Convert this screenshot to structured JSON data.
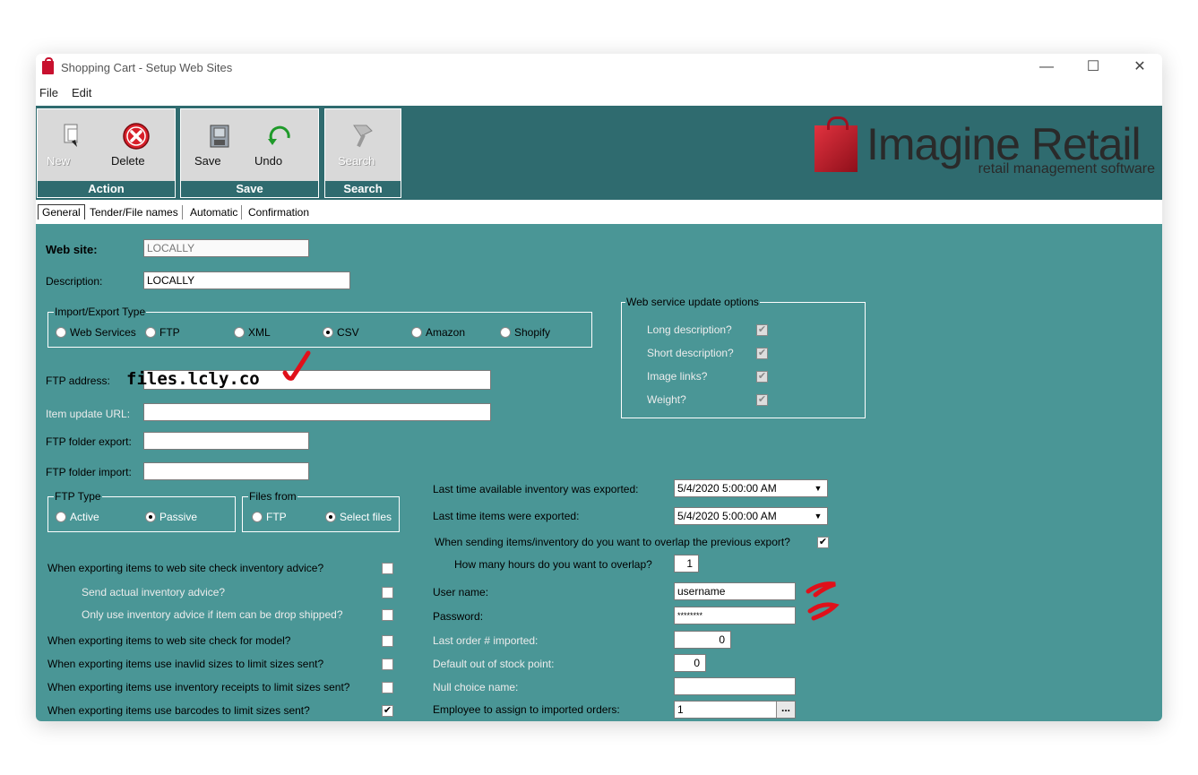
{
  "window": {
    "title": "Shopping Cart - Setup Web Sites",
    "controls": {
      "minimize": "—",
      "maximize": "☐",
      "close": "✕"
    }
  },
  "menu": [
    "File",
    "Edit"
  ],
  "toolbar": {
    "groups": [
      {
        "caption": "Action",
        "buttons": [
          {
            "label": "New",
            "icon": "new-document-icon",
            "enabled": false
          },
          {
            "label": "Delete",
            "icon": "delete-icon",
            "enabled": true
          }
        ]
      },
      {
        "caption": "Save",
        "buttons": [
          {
            "label": "Save",
            "icon": "save-icon",
            "enabled": true
          },
          {
            "label": "Undo",
            "icon": "undo-icon",
            "enabled": true
          }
        ]
      },
      {
        "caption": "Search",
        "buttons": [
          {
            "label": "Search",
            "icon": "search-icon",
            "enabled": false
          }
        ]
      }
    ]
  },
  "logo": {
    "name": "Imagine Retail",
    "tagline": "retail management software"
  },
  "tabs": [
    "General",
    "Tender/File names",
    "Automatic",
    "Confirmation"
  ],
  "form": {
    "web_site": {
      "label": "Web site:",
      "value": "LOCALLY"
    },
    "description": {
      "label": "Description:",
      "value": "LOCALLY"
    },
    "import_export": {
      "title": "Import/Export Type",
      "options": [
        "Web Services",
        "FTP",
        "XML",
        "CSV",
        "Amazon",
        "Shopify"
      ],
      "selected": "CSV"
    },
    "ftp_address": {
      "label": "FTP address:",
      "value": "files.lcly.co"
    },
    "item_update_url": {
      "label": "Item update URL:",
      "value": ""
    },
    "ftp_folder_export": {
      "label": "FTP folder export:",
      "value": ""
    },
    "ftp_folder_import": {
      "label": "FTP folder import:",
      "value": ""
    },
    "ftp_type": {
      "title": "FTP Type",
      "options": [
        "Active",
        "Passive"
      ],
      "selected": "Passive"
    },
    "files_from": {
      "title": "Files from",
      "options": [
        "FTP",
        "Select files"
      ],
      "selected": "Select files"
    },
    "web_service_options": {
      "title": "Web service update options",
      "items": [
        {
          "label": "Long description?",
          "checked": true
        },
        {
          "label": "Short description?",
          "checked": true
        },
        {
          "label": "Image links?",
          "checked": true
        },
        {
          "label": "Weight?",
          "checked": true
        }
      ]
    },
    "left_checks": [
      {
        "label": "When exporting items to web site check inventory advice?",
        "checked": false
      },
      {
        "label": "Send actual inventory advice?",
        "checked": false
      },
      {
        "label": "Only use inventory advice if item can be drop shipped?",
        "checked": false
      },
      {
        "label": "When exporting items to web site check for model?",
        "checked": false
      },
      {
        "label": "When exporting items use inavlid sizes to limit sizes sent?",
        "checked": false
      },
      {
        "label": "When exporting items use inventory receipts to limit sizes sent?",
        "checked": false
      },
      {
        "label": "When exporting items use barcodes to limit sizes sent?",
        "checked": true
      }
    ],
    "last_inventory_export": {
      "label": "Last time available inventory was exported:",
      "value": "5/4/2020 5:00:00 AM"
    },
    "last_items_export": {
      "label": "Last time items were exported:",
      "value": "5/4/2020 5:00:00 AM"
    },
    "overlap_question": {
      "label": "When sending items/inventory do you want to overlap the previous export?",
      "checked": true
    },
    "overlap_hours": {
      "label": "How many hours do you want  to overlap?",
      "value": "1"
    },
    "user_name": {
      "label": "User name:",
      "value": "username"
    },
    "password": {
      "label": "Password:",
      "value": "********"
    },
    "last_order": {
      "label": "Last order # imported:",
      "value": "0"
    },
    "default_oos": {
      "label": "Default out of stock point:",
      "value": "0"
    },
    "null_choice": {
      "label": "Null choice name:",
      "value": ""
    },
    "employee": {
      "label": "Employee to assign to imported orders:",
      "value": "1",
      "button": "..."
    }
  },
  "colors": {
    "toolbar_bg": "#2f6b6f",
    "content_bg": "#4a9696",
    "annotation_red": "#e0101a"
  }
}
